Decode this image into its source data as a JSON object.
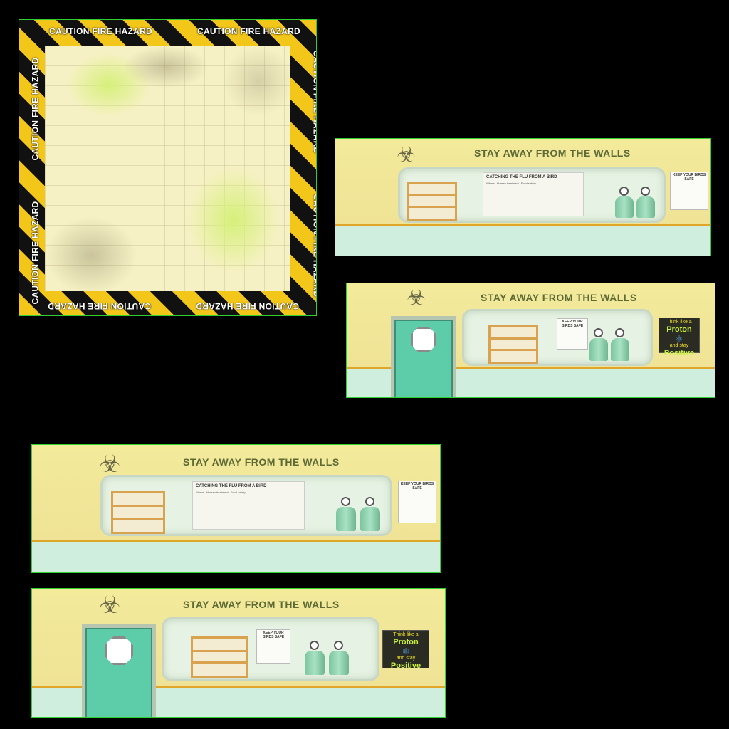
{
  "floor": {
    "caution_label": "CAUTION FIRE HAZARD"
  },
  "walls": [
    {
      "title": "STAY AWAY FROM THE WALLS",
      "poster_title": "CATCHING THE FLU FROM A BIRD",
      "poster_columns": [
        "Where",
        "Human treatment",
        "Food safety"
      ],
      "sign_text": "KEEP YOUR BIRDS SAFE"
    },
    {
      "title": "STAY AWAY FROM THE WALLS",
      "sign_text": "KEEP YOUR BIRDS SAFE",
      "proton_lines": [
        "Think like a",
        "Proton",
        "and stay",
        "Positive"
      ]
    },
    {
      "title": "STAY AWAY FROM THE WALLS",
      "poster_title": "CATCHING THE FLU FROM A BIRD",
      "poster_columns": [
        "Where",
        "Human treatment",
        "Food safety"
      ],
      "sign_text": "KEEP YOUR BIRDS SAFE"
    },
    {
      "title": "STAY AWAY FROM THE WALLS",
      "sign_text": "KEEP YOUR BIRDS SAFE",
      "proton_lines": [
        "Think like a",
        "Proton",
        "and stay",
        "Positive"
      ]
    }
  ],
  "colors": {
    "sprite_outline": "#2fd12f",
    "caution_yellow": "#f3c61a",
    "wall_yellow": "#f3ea9a",
    "wall_green": "#cfeedd",
    "door_teal": "#5ccda8"
  },
  "icons": [
    "biohazard-icon",
    "atom-icon"
  ]
}
